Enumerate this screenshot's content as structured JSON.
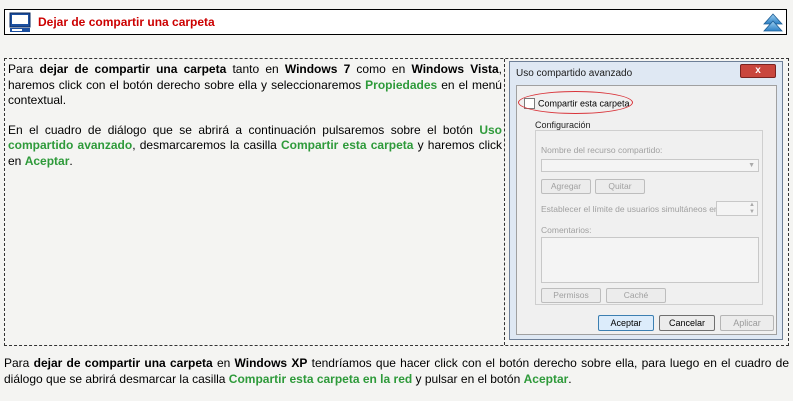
{
  "header": {
    "title": "Dejar de compartir una carpeta",
    "left_icon": "computer-icon",
    "right_icon": "scroll-up-icon"
  },
  "paragraph1": {
    "t1": "Para ",
    "b1": "dejar de compartir una carpeta",
    "t2": " tanto en ",
    "b2": "Windows 7",
    "t3": " como en ",
    "b3": "Windows Vista",
    "t4": ", haremos click con el botón derecho sobre ella y seleccionaremos ",
    "g1": "Propiedades",
    "t5": " en el menú contextual."
  },
  "paragraph2": {
    "t1": "En el cuadro de diálogo que se abrirá a continuación pulsaremos sobre el botón ",
    "g1": "Uso compartido avanzado",
    "t2": ", desmarcaremos la casilla ",
    "g2": "Compartir esta carpeta",
    "t3": " y haremos click en ",
    "g3": "Aceptar",
    "t4": "."
  },
  "dialog": {
    "title": "Uso compartido avanzado",
    "close_label": "x",
    "checkbox_label": "Compartir esta carpeta",
    "group_label": "Configuración",
    "share_name_label": "Nombre del recurso compartido:",
    "add_label": "Agregar",
    "remove_label": "Quitar",
    "limit_label": "Establecer el límite de usuarios simultáneos en:",
    "comments_label": "Comentarios:",
    "permissions_label": "Permisos",
    "cache_label": "Caché",
    "ok_label": "Aceptar",
    "cancel_label": "Cancelar",
    "apply_label": "Aplicar"
  },
  "bottom": {
    "t1": "Para ",
    "b1": "dejar de compartir una carpeta",
    "t2": " en ",
    "b2": "Windows XP",
    "t3": " tendríamos que hacer click con el botón derecho sobre ella, para luego en el cuadro de diálogo que se abrirá desmarcar la casilla ",
    "g1": "Compartir esta carpeta en la red",
    "t4": " y pulsar en el botón ",
    "g2": "Aceptar",
    "t5": "."
  },
  "colors": {
    "title": "#cc0000",
    "highlight": "#2e9a3a",
    "oval": "#d9343a"
  }
}
